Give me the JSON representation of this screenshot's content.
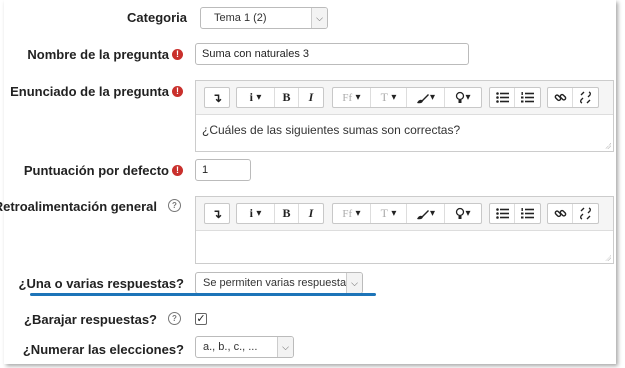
{
  "form": {
    "category": {
      "label": "Categoria",
      "value": "Tema 1 (2)"
    },
    "question_name": {
      "label": "Nombre de la pregunta",
      "value": "Suma con naturales 3"
    },
    "question_text": {
      "label": "Enunciado de la pregunta",
      "content": "¿Cuáles de las siguientes sumas son correctas?"
    },
    "default_mark": {
      "label": "Puntuación por defecto",
      "value": "1"
    },
    "general_feedback": {
      "label": "Retroalimentación general",
      "content": ""
    },
    "single_answer": {
      "label": "¿Una o varias respuestas?",
      "value": "Se permiten varias respuestas"
    },
    "shuffle": {
      "label": "¿Barajar respuestas?",
      "checked": true,
      "check_glyph": "✓"
    },
    "numbering": {
      "label": "¿Numerar las elecciones?",
      "value": "a., b., c., ..."
    }
  },
  "icons": {
    "required": "!",
    "help": "?"
  },
  "toolbar": {
    "expand": "↴",
    "info": "i",
    "bold": "B",
    "italic": "I",
    "font": "Ff",
    "text_size": "T",
    "caret": "▾"
  },
  "colors": {
    "highlight_underline": "#1d74b8",
    "required_icon": "#c9302c"
  }
}
